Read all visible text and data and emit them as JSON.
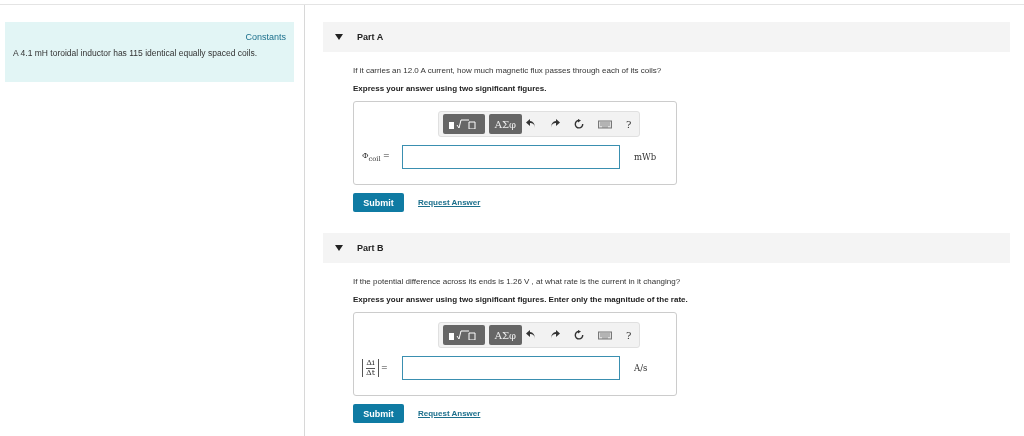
{
  "sidebar": {
    "link": "Constants",
    "problem": "A 4.1 mH toroidal inductor has 115 identical equally spaced coils."
  },
  "parts": [
    {
      "title": "Part A",
      "expanded": true,
      "question": "If it carries an 12.0 A current, how much magnetic flux passes through each of its coils?",
      "instruction": "Express your answer using two significant figures.",
      "toolbar": [
        {
          "kind": "templates"
        },
        {
          "kind": "symbols",
          "label": "ΑΣφ"
        },
        {
          "kind": "undo"
        },
        {
          "kind": "redo"
        },
        {
          "kind": "reset"
        },
        {
          "kind": "keyboard"
        },
        {
          "kind": "help",
          "label": "?"
        }
      ],
      "label": {
        "kind": "text",
        "text": "Φ$_{coil}$ ="
      },
      "unit": "mWb",
      "submit": "Submit",
      "request": "Request Answer"
    },
    {
      "title": "Part B",
      "expanded": true,
      "question": "If the potential difference across its ends is 1.26 V , at what rate is the current in it changing?",
      "instruction": "Express your answer using two significant figures. Enter only the magnitude of the rate.",
      "toolbar": [
        {
          "kind": "templates"
        },
        {
          "kind": "symbols",
          "label": "ΑΣφ"
        },
        {
          "kind": "undo"
        },
        {
          "kind": "redo"
        },
        {
          "kind": "reset"
        },
        {
          "kind": "keyboard"
        },
        {
          "kind": "help",
          "label": "?"
        }
      ],
      "label": {
        "kind": "fraction",
        "numerator": "Δi",
        "denominator": "Δt",
        "suffix": "="
      },
      "unit": "A/s",
      "submit": "Submit",
      "request": "Request Answer"
    }
  ]
}
